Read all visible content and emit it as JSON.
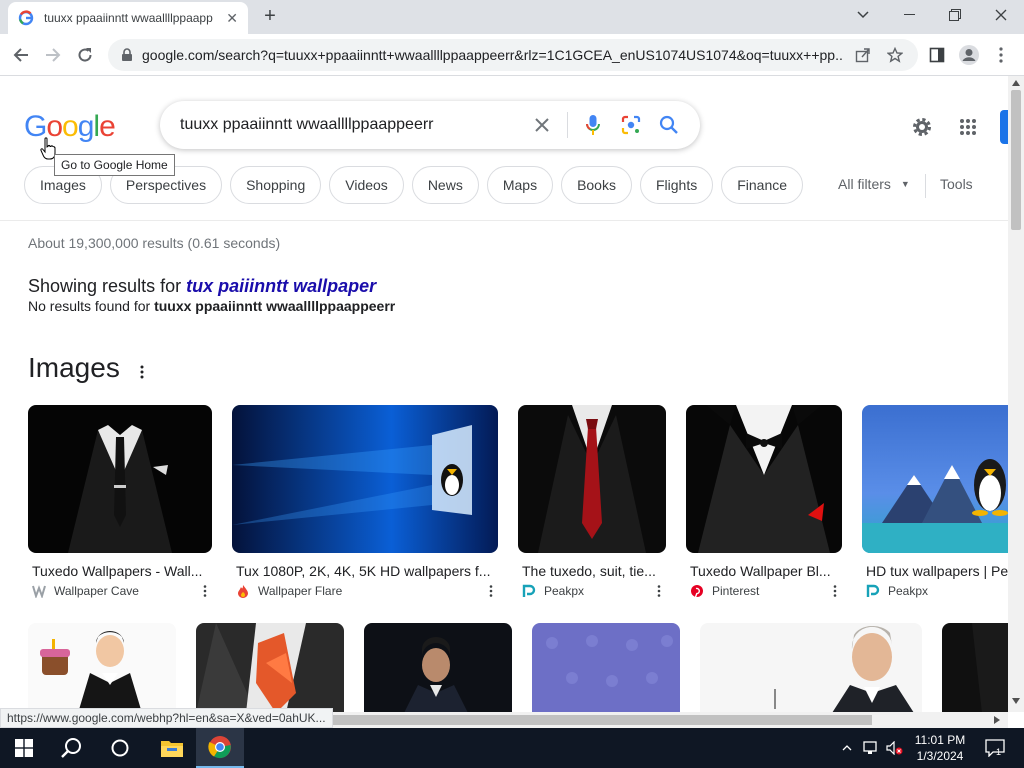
{
  "browser": {
    "tab_title": "tuuxx ppaaiinntt wwaallllppaapp",
    "url": "google.com/search?q=tuuxx+ppaaiinntt+wwaallllppaappeerr&rlz=1C1GCEA_enUS1074US1074&oq=tuuxx++pp..."
  },
  "logo": {
    "letters": [
      "G",
      "o",
      "o",
      "g",
      "l",
      "e"
    ],
    "colors": [
      "#4285f4",
      "#ea4335",
      "#fbbc05",
      "#4285f4",
      "#34a853",
      "#ea4335"
    ]
  },
  "search": {
    "query": "tuuxx ppaaiinntt wwaallllppaappeerr"
  },
  "tooltip": "Go to Google Home",
  "chips": [
    "Images",
    "Perspectives",
    "Shopping",
    "Videos",
    "News",
    "Maps",
    "Books",
    "Flights",
    "Finance"
  ],
  "all_filters": "All filters",
  "tools": "Tools",
  "stats": "About 19,300,000 results (0.61 seconds)",
  "correction": {
    "prefix": "Showing results for ",
    "corrected": "tux paiiinntt wallpaper",
    "noresults_prefix": "No results found for ",
    "original": "tuuxx ppaaiinntt wwaallllppaappeerr"
  },
  "images_heading": "Images",
  "image_results": [
    {
      "title": "Tuxedo Wallpapers - Wall...",
      "source": "Wallpaper Cave"
    },
    {
      "title": "Tux 1080P, 2K, 4K, 5K HD wallpapers f...",
      "source": "Wallpaper Flare"
    },
    {
      "title": "The tuxedo, suit, tie...",
      "source": "Peakpx"
    },
    {
      "title": "Tuxedo Wallpaper Bl...",
      "source": "Pinterest"
    },
    {
      "title": "HD tux wallpapers | Pe",
      "source": "Peakpx"
    }
  ],
  "status_url": "https://www.google.com/webhp?hl=en&sa=X&ved=0ahUK...",
  "taskbar": {
    "time": "11:01 PM",
    "date": "1/3/2024",
    "notifications": "1"
  }
}
